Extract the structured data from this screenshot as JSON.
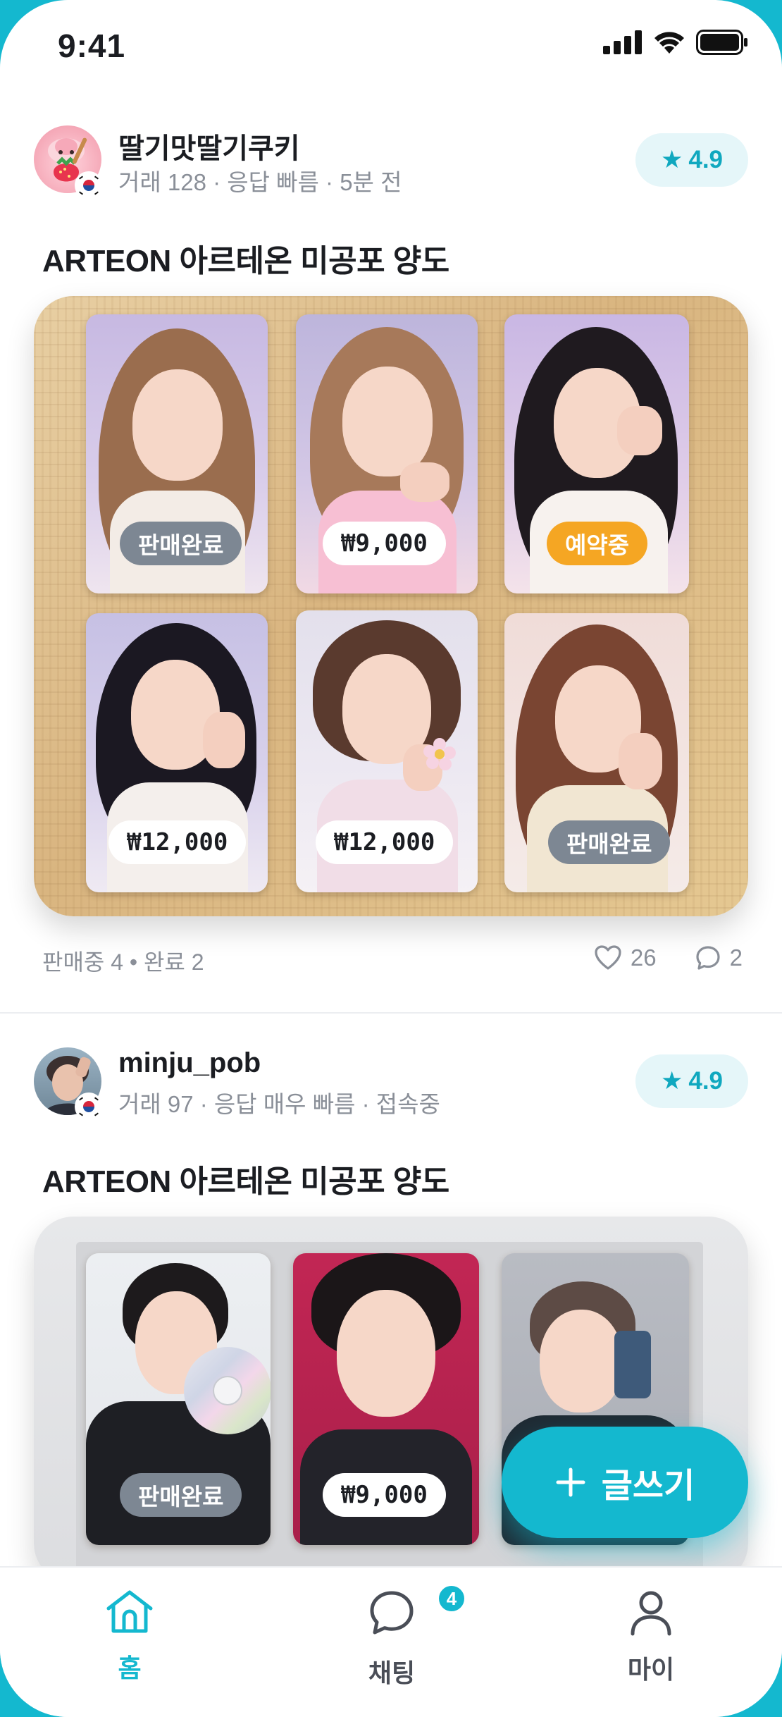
{
  "status_bar": {
    "time": "9:41"
  },
  "posts": [
    {
      "seller": "딸기맛딸기쿠키",
      "meta": "거래 128 · 응답 빠름 · 5분 전",
      "rating": "4.9",
      "title": "ARTEON 아르테온 미공포 양도",
      "cards": [
        {
          "tag": "판매완료",
          "tag_type": "sold"
        },
        {
          "tag": "₩9,000",
          "tag_type": "price"
        },
        {
          "tag": "예약중",
          "tag_type": "reserved"
        },
        {
          "tag": "₩12,000",
          "tag_type": "price"
        },
        {
          "tag": "₩12,000",
          "tag_type": "price"
        },
        {
          "tag": "판매완료",
          "tag_type": "sold"
        }
      ],
      "stats": "판매중 4 • 완료 2",
      "likes": "26",
      "comments": "2"
    },
    {
      "seller": "minju_pob",
      "meta": "거래 97 · 응답 매우 빠름 · 접속중",
      "rating": "4.9",
      "title": "ARTEON 아르테온 미공포 양도",
      "cards": [
        {
          "tag": "판매완료",
          "tag_type": "sold"
        },
        {
          "tag": "₩9,000",
          "tag_type": "price"
        },
        {
          "tag": "",
          "tag_type": "none"
        }
      ]
    }
  ],
  "fab": {
    "icon": "plus-icon",
    "label": "글쓰기"
  },
  "tabbar": {
    "items": [
      {
        "label": "홈",
        "icon": "home-icon",
        "active": true
      },
      {
        "label": "채팅",
        "icon": "chat-icon",
        "badge": "4"
      },
      {
        "label": "마이",
        "icon": "profile-icon"
      }
    ]
  },
  "colors": {
    "accent": "#14b8cf",
    "sold": "#7d8793",
    "reserved": "#f5a623",
    "muted": "#8a8f98"
  }
}
